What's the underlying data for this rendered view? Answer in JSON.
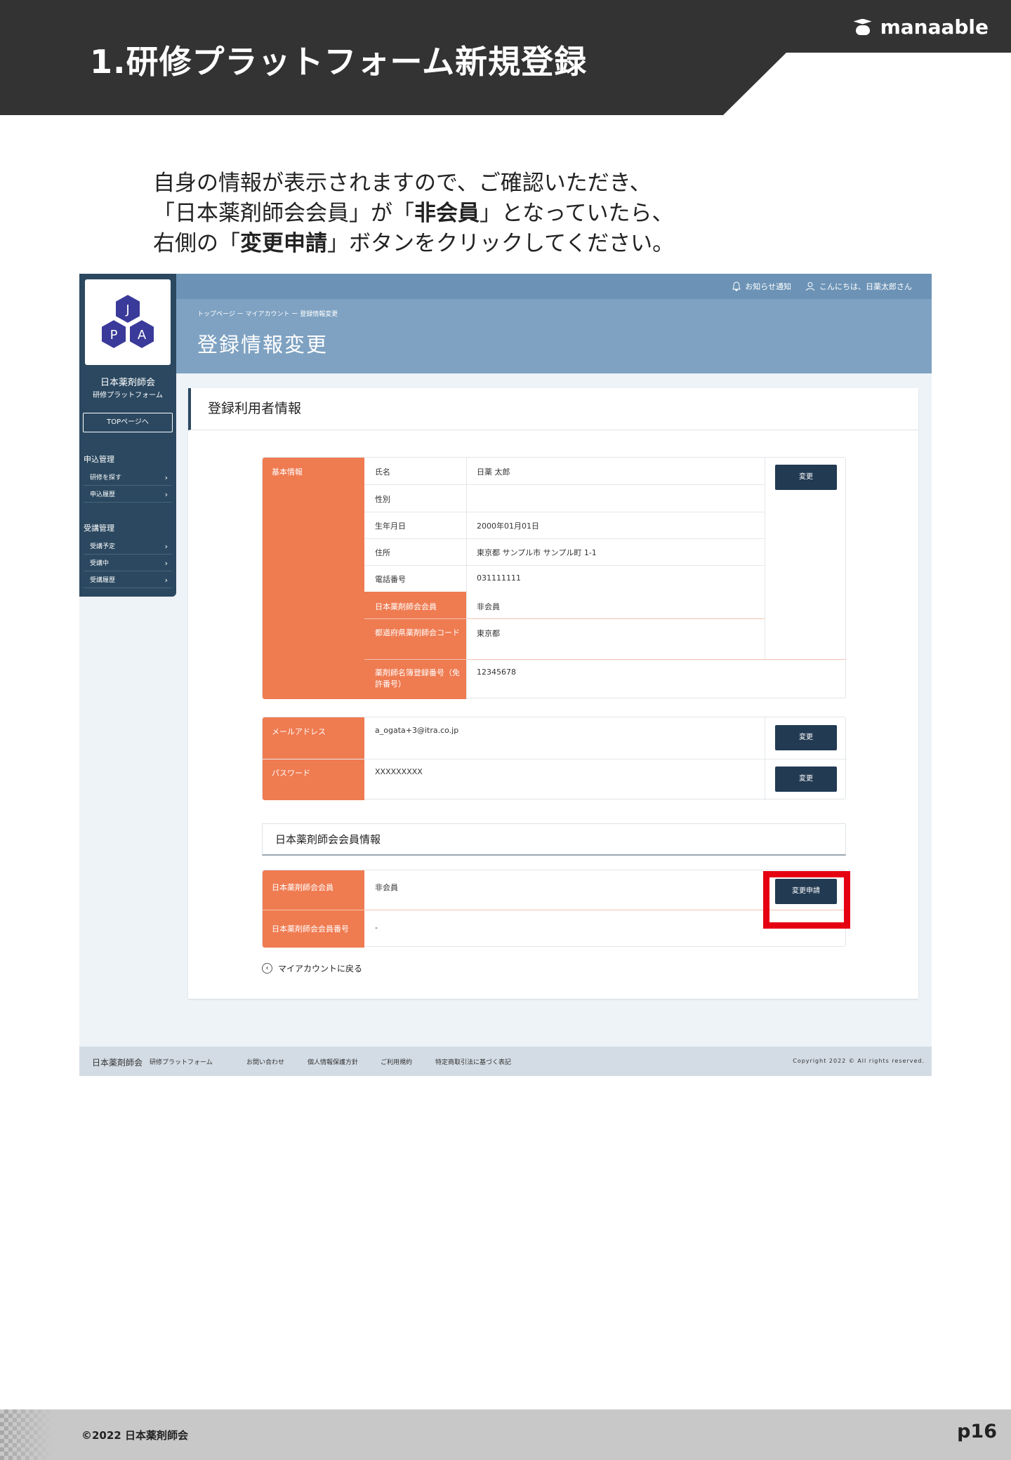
{
  "slide": {
    "title": "1.研修プラットフォーム新規登録",
    "brand": "manaable",
    "instruction": {
      "line1": "自身の情報が表示されますので、ご確認いただき、",
      "line2_a": "「日本薬剤師会会員」が「",
      "line2_b": "非会員",
      "line2_c": "」となっていたら、",
      "line3_a": "右側の「",
      "line3_b": "変更申請",
      "line3_c": "」ボタンをクリックしてください。"
    },
    "copyright": "©2022 日本薬剤師会",
    "page": "p16"
  },
  "screenshot": {
    "sidebar": {
      "org_name": "日本薬剤師会",
      "platform": "研修プラットフォーム",
      "top_button": "TOPページへ",
      "section1": "申込管理",
      "section1_items": [
        "研修を探す",
        "申込履歴"
      ],
      "section2": "受講管理",
      "section2_items": [
        "受講予定",
        "受講中",
        "受講履歴"
      ]
    },
    "header": {
      "notice": "お知らせ通知",
      "greeting": "こんにちは、日薬太郎さん",
      "breadcrumb": "トップページ ー マイアカウント ー 登録情報変更",
      "title": "登録情報変更"
    },
    "card_title": "登録利用者情報",
    "basic": {
      "label": "基本情報",
      "rows": [
        {
          "label": "氏名",
          "value": "日薬 太郎"
        },
        {
          "label": "性別",
          "value": ""
        },
        {
          "label": "生年月日",
          "value": "2000年01月01日"
        },
        {
          "label": "住所",
          "value": "東京都 サンプル市 サンプル町 1-1"
        },
        {
          "label": "電話番号",
          "value": "031111111"
        },
        {
          "label": "日本薬剤師会会員",
          "value": "非会員"
        },
        {
          "label": "都道府県薬剤師会コード",
          "value": "東京都"
        },
        {
          "label": "薬剤師名簿登録番号（免許番号）",
          "value": "12345678"
        }
      ],
      "change_button": "変更"
    },
    "account": {
      "email_label": "メールアドレス",
      "email_value": "a_ogata+3@itra.co.jp",
      "password_label": "パスワード",
      "password_value": "XXXXXXXXX",
      "change_button": "変更"
    },
    "membership": {
      "section_title": "日本薬剤師会会員情報",
      "member_label": "日本薬剤師会会員",
      "member_value": "非会員",
      "number_label": "日本薬剤師会会員番号",
      "number_value": "-",
      "apply_button": "変更申請"
    },
    "back_link": "マイアカウントに戻る",
    "footer": {
      "org": "日本薬剤師会",
      "platform": "研修プラットフォーム",
      "links": [
        "お問い合わせ",
        "個人情報保護方針",
        "ご利用規約",
        "特定商取引法に基づく表記"
      ],
      "copyright": "Copyright 2022 © All rights reserved."
    }
  },
  "colors": {
    "accent_orange": "#ef7b51",
    "navy": "#223a52",
    "highlight_red": "#e50012"
  }
}
